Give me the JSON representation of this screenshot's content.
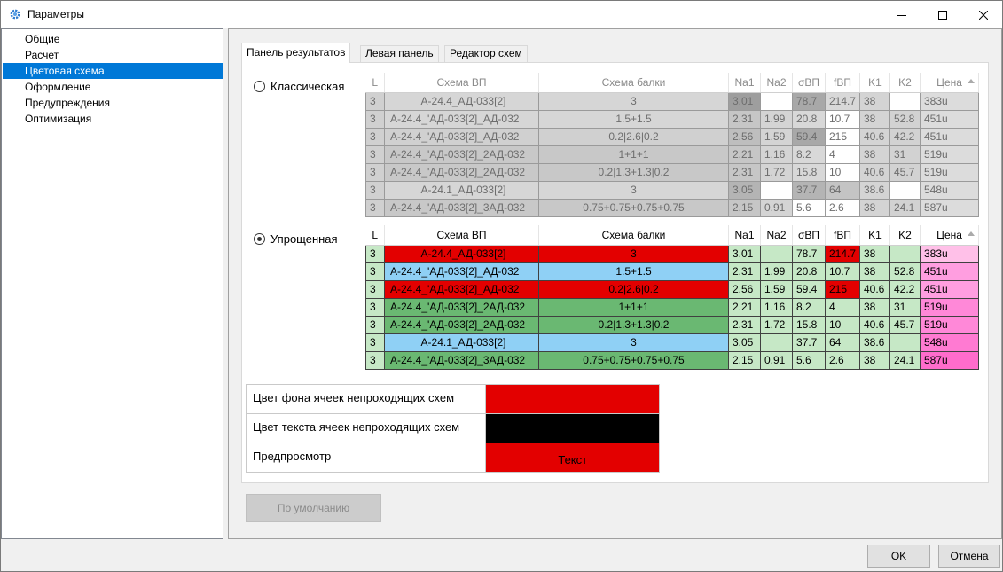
{
  "window": {
    "title": "Параметры",
    "icon": "gear-icon"
  },
  "sidebar": {
    "items": [
      {
        "label": "Общие"
      },
      {
        "label": "Расчет"
      },
      {
        "label": "Цветовая схема",
        "selected": true
      },
      {
        "label": "Оформление"
      },
      {
        "label": "Предупреждения"
      },
      {
        "label": "Оптимизация"
      }
    ]
  },
  "tabs": [
    {
      "label": "Панель результатов",
      "active": true
    },
    {
      "label": "Левая панель"
    },
    {
      "label": "Редактор схем"
    }
  ],
  "classic": {
    "radio_label": "Классическая",
    "columns": [
      "L",
      "Схема ВП",
      "Схема балки",
      "Na1",
      "Na2",
      "σВП",
      "fВП",
      "K1",
      "K2",
      "Цена"
    ],
    "rows": [
      [
        "3",
        "А-24.4_АД-033[2]",
        "3",
        "3.01",
        "",
        "78.7",
        "214.7",
        "38",
        "",
        "383u"
      ],
      [
        "3",
        "А-24.4_'АД-033[2]_АД-032",
        "1.5+1.5",
        "2.31",
        "1.99",
        "20.8",
        "10.7",
        "38",
        "52.8",
        "451u"
      ],
      [
        "3",
        "А-24.4_'АД-033[2]_АД-032",
        "0.2|2.6|0.2",
        "2.56",
        "1.59",
        "59.4",
        "215",
        "40.6",
        "42.2",
        "451u"
      ],
      [
        "3",
        "А-24.4_'АД-033[2]_2АД-032",
        "1+1+1",
        "2.21",
        "1.16",
        "8.2",
        "4",
        "38",
        "31",
        "519u"
      ],
      [
        "3",
        "А-24.4_'АД-033[2]_2АД-032",
        "0.2|1.3+1.3|0.2",
        "2.31",
        "1.72",
        "15.8",
        "10",
        "40.6",
        "45.7",
        "519u"
      ],
      [
        "3",
        "А-24.1_АД-033[2]",
        "3",
        "3.05",
        "",
        "37.7",
        "64",
        "38.6",
        "",
        "548u"
      ],
      [
        "3",
        "А-24.4_'АД-033[2]_3АД-032",
        "0.75+0.75+0.75+0.75",
        "2.15",
        "0.91",
        "5.6",
        "2.6",
        "38",
        "24.1",
        "587u"
      ]
    ],
    "colors": [
      [
        "#d0d0d0",
        "#d6d6d6",
        "#d6d6d6",
        "#9e9e9e",
        "#ffffff",
        "#a8a8a8",
        "#d8d8d8",
        "#d4d4d4",
        "#ffffff",
        "#dcdcdc"
      ],
      [
        "#d0d0d0",
        "#d6d6d6",
        "#d6d6d6",
        "#c6c6c6",
        "#d4d4d4",
        "#d8d8d8",
        "#ffffff",
        "#d4d4d4",
        "#d2d2d2",
        "#dcdcdc"
      ],
      [
        "#d0d0d0",
        "#d0d0d0",
        "#d0d0d0",
        "#bebebe",
        "#d4d4d4",
        "#a8a8a8",
        "#ffffff",
        "#d4d4d4",
        "#d2d2d2",
        "#dcdcdc"
      ],
      [
        "#d0d0d0",
        "#c8c8c8",
        "#c8c8c8",
        "#c6c6c6",
        "#d4d4d4",
        "#d8d8d8",
        "#ffffff",
        "#d4d4d4",
        "#d2d2d2",
        "#dcdcdc"
      ],
      [
        "#d0d0d0",
        "#c8c8c8",
        "#c8c8c8",
        "#c6c6c6",
        "#d4d4d4",
        "#d8d8d8",
        "#ffffff",
        "#d4d4d4",
        "#d2d2d2",
        "#dcdcdc"
      ],
      [
        "#d0d0d0",
        "#d6d6d6",
        "#d6d6d6",
        "#b4b4b4",
        "#ffffff",
        "#b4b4b4",
        "#c4c4c4",
        "#d4d4d4",
        "#ffffff",
        "#dcdcdc"
      ],
      [
        "#d0d0d0",
        "#c8c8c8",
        "#c8c8c8",
        "#c6c6c6",
        "#d4d4d4",
        "#ffffff",
        "#ffffff",
        "#d4d4d4",
        "#d2d2d2",
        "#dcdcdc"
      ]
    ]
  },
  "simple": {
    "radio_label": "Упрощенная",
    "columns": [
      "L",
      "Схема ВП",
      "Схема балки",
      "Na1",
      "Na2",
      "σВП",
      "fВП",
      "K1",
      "K2",
      "Цена"
    ],
    "rows": [
      [
        "3",
        "А-24.4_АД-033[2]",
        "3",
        "3.01",
        "",
        "78.7",
        "214.7",
        "38",
        "",
        "383u"
      ],
      [
        "3",
        "А-24.4_'АД-033[2]_АД-032",
        "1.5+1.5",
        "2.31",
        "1.99",
        "20.8",
        "10.7",
        "38",
        "52.8",
        "451u"
      ],
      [
        "3",
        "А-24.4_'АД-033[2]_АД-032",
        "0.2|2.6|0.2",
        "2.56",
        "1.59",
        "59.4",
        "215",
        "40.6",
        "42.2",
        "451u"
      ],
      [
        "3",
        "А-24.4_'АД-033[2]_2АД-032",
        "1+1+1",
        "2.21",
        "1.16",
        "8.2",
        "4",
        "38",
        "31",
        "519u"
      ],
      [
        "3",
        "А-24.4_'АД-033[2]_2АД-032",
        "0.2|1.3+1.3|0.2",
        "2.31",
        "1.72",
        "15.8",
        "10",
        "40.6",
        "45.7",
        "519u"
      ],
      [
        "3",
        "А-24.1_АД-033[2]",
        "3",
        "3.05",
        "",
        "37.7",
        "64",
        "38.6",
        "",
        "548u"
      ],
      [
        "3",
        "А-24.4_'АД-033[2]_3АД-032",
        "0.75+0.75+0.75+0.75",
        "2.15",
        "0.91",
        "5.6",
        "2.6",
        "38",
        "24.1",
        "587u"
      ]
    ],
    "colors": [
      [
        "#c6e8c6",
        "#e30000",
        "#e30000",
        "#c6e8c6",
        "#c6e8c6",
        "#c6e8c6",
        "#e30000",
        "#c6e8c6",
        "#c6e8c6",
        "#ffc0e8"
      ],
      [
        "#c6e8c6",
        "#8fd0f5",
        "#8fd0f5",
        "#c6e8c6",
        "#c6e8c6",
        "#c6e8c6",
        "#c6e8c6",
        "#c6e8c6",
        "#c6e8c6",
        "#ff9ee0"
      ],
      [
        "#c6e8c6",
        "#e30000",
        "#e30000",
        "#c6e8c6",
        "#c6e8c6",
        "#c6e8c6",
        "#e30000",
        "#c6e8c6",
        "#c6e8c6",
        "#ff9ee0"
      ],
      [
        "#c6e8c6",
        "#6ab872",
        "#6ab872",
        "#c6e8c6",
        "#c6e8c6",
        "#c6e8c6",
        "#c6e8c6",
        "#c6e8c6",
        "#c6e8c6",
        "#ff88d8"
      ],
      [
        "#c6e8c6",
        "#6ab872",
        "#6ab872",
        "#c6e8c6",
        "#c6e8c6",
        "#c6e8c6",
        "#c6e8c6",
        "#c6e8c6",
        "#c6e8c6",
        "#ff88d8"
      ],
      [
        "#c6e8c6",
        "#8fd0f5",
        "#8fd0f5",
        "#c6e8c6",
        "#c6e8c6",
        "#c6e8c6",
        "#c6e8c6",
        "#c6e8c6",
        "#c6e8c6",
        "#ff7ad2"
      ],
      [
        "#c6e8c6",
        "#6ab872",
        "#6ab872",
        "#c6e8c6",
        "#c6e8c6",
        "#c6e8c6",
        "#c6e8c6",
        "#c6e8c6",
        "#c6e8c6",
        "#ff6ccc"
      ]
    ]
  },
  "settings": {
    "bg_label": "Цвет фона ячеек непроходящих схем",
    "bg_color": "#e30000",
    "text_label": "Цвет текста ячеек непроходящих схем",
    "text_color": "#000000",
    "preview_label": "Предпросмотр",
    "preview_text": "Текст"
  },
  "buttons": {
    "default": "По умолчанию",
    "ok": "OK",
    "cancel": "Отмена"
  }
}
